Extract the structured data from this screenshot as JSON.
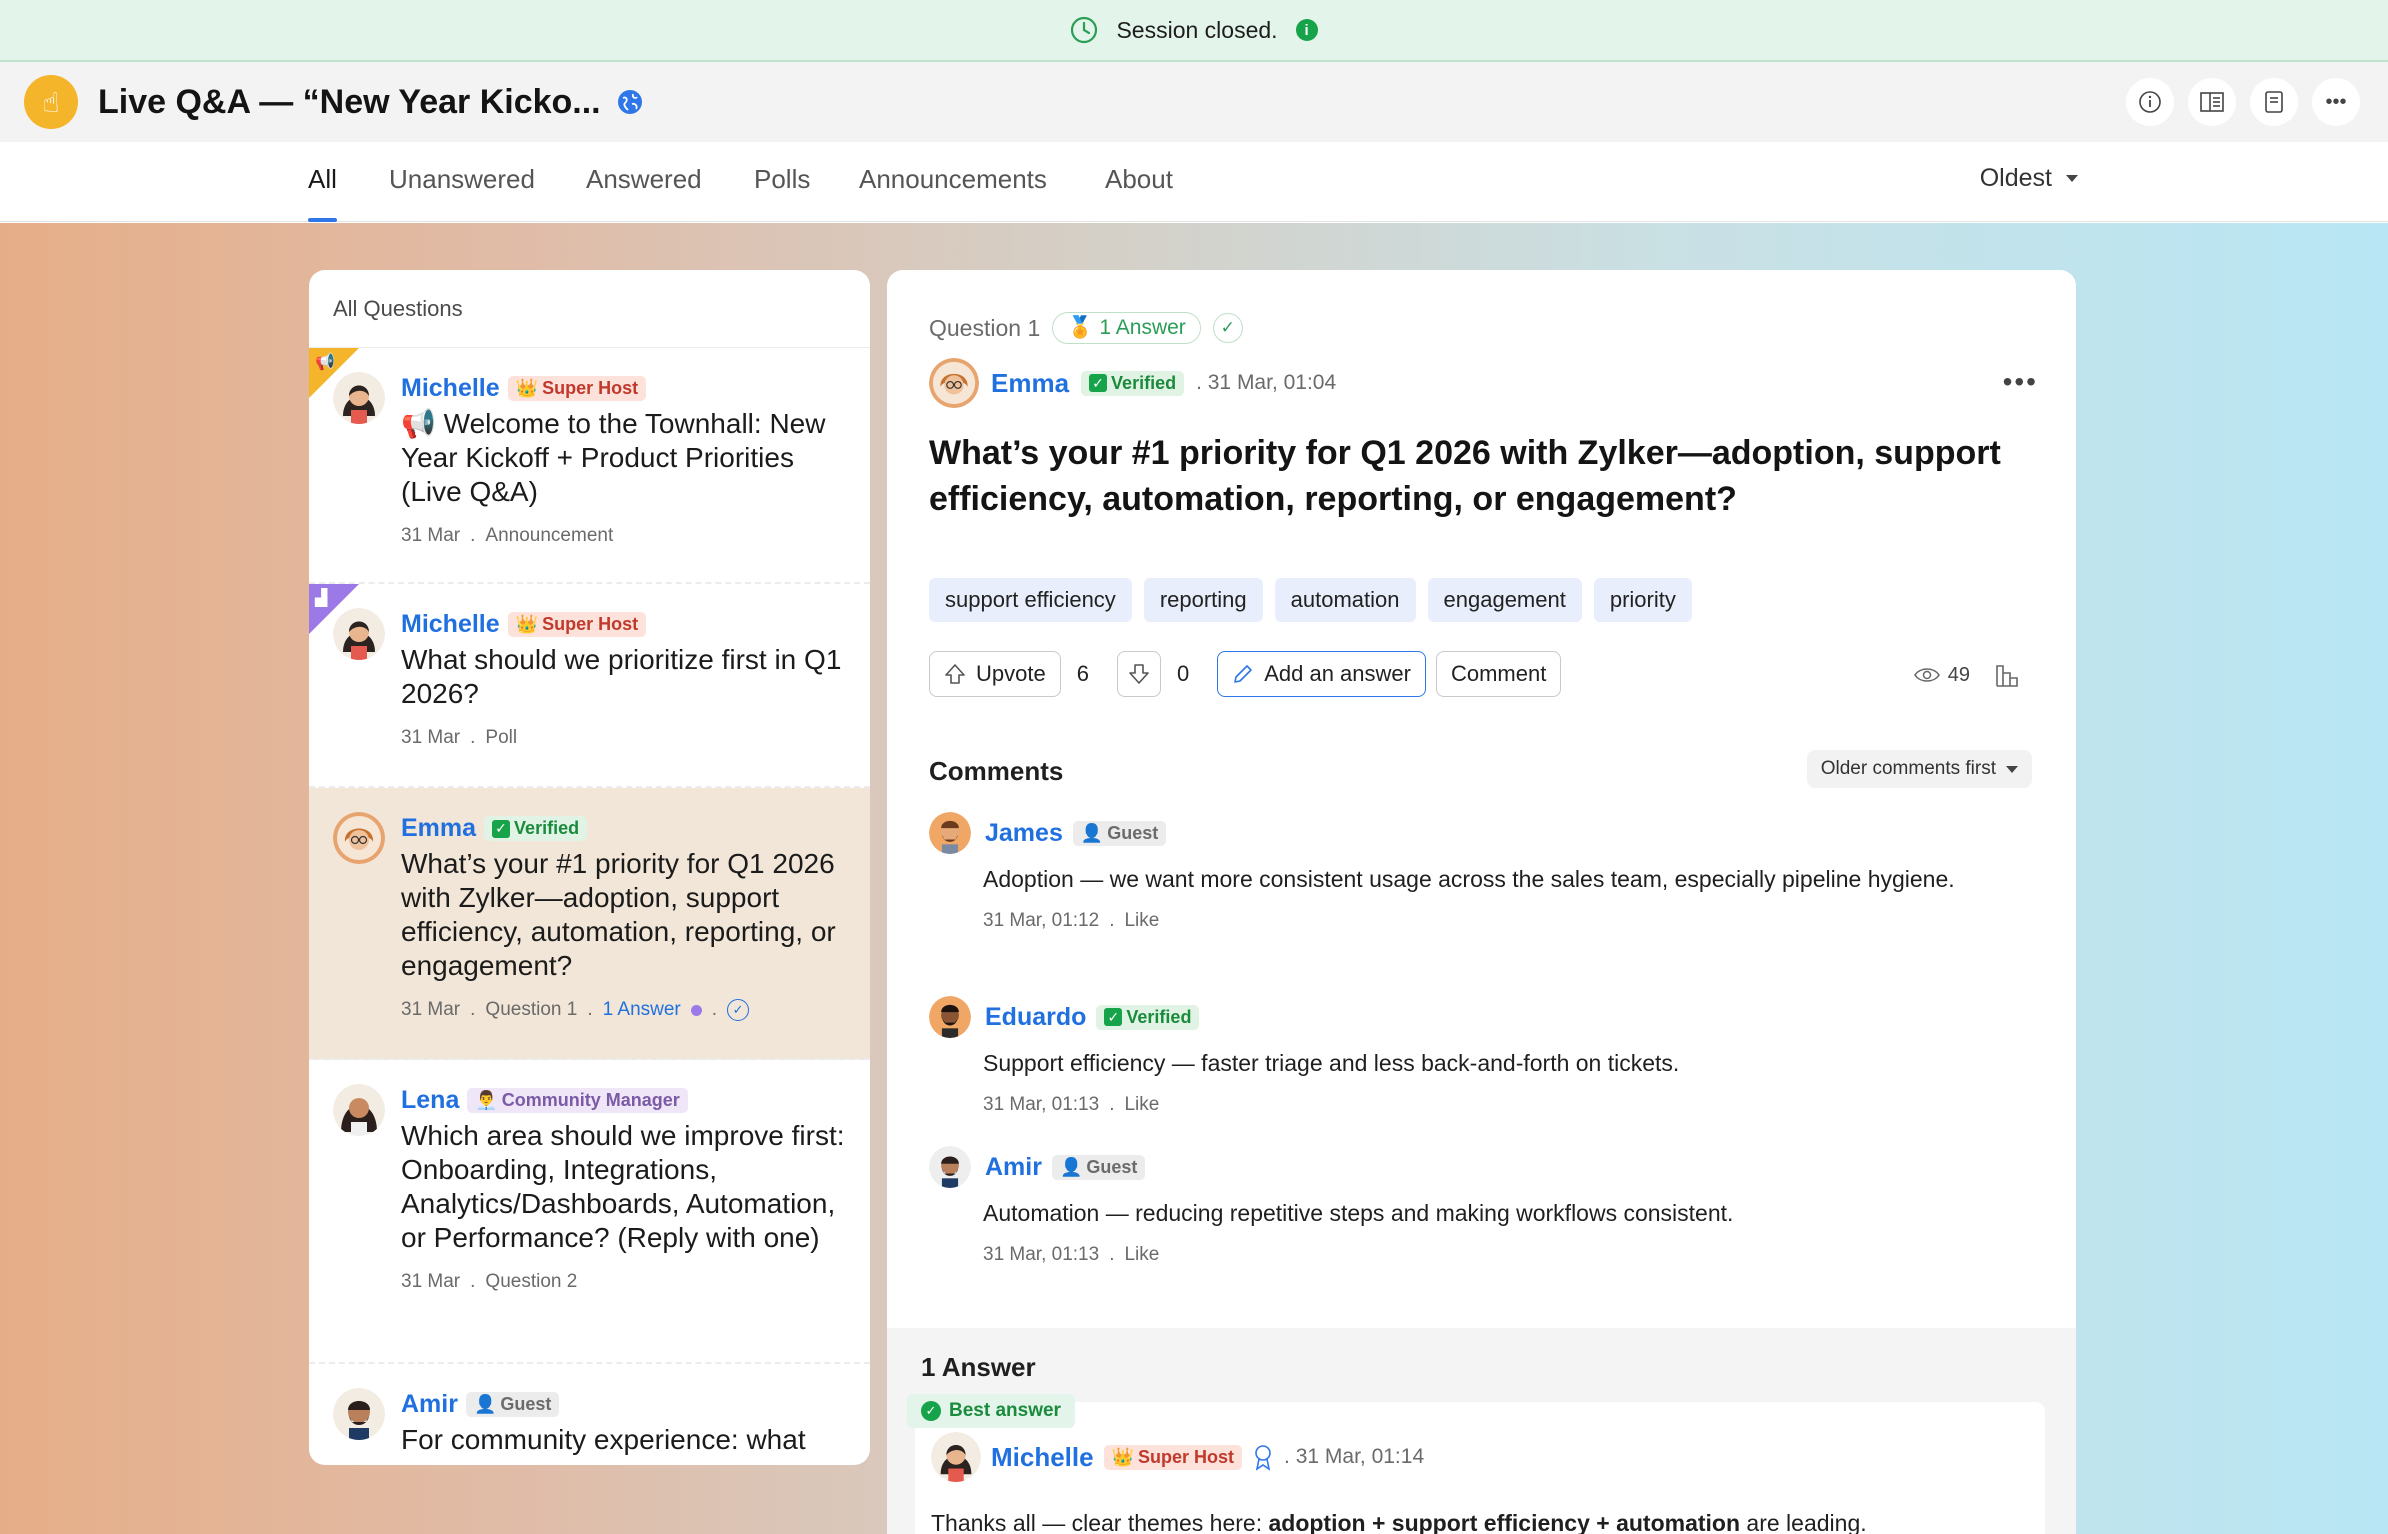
{
  "banner": {
    "text": "Session closed.",
    "info": "i"
  },
  "header": {
    "logo_glyph": "☝",
    "title": "Live Q&A — “New Year Kicko..."
  },
  "tabs": [
    {
      "label": "All",
      "active": true
    },
    {
      "label": "Unanswered"
    },
    {
      "label": "Answered"
    },
    {
      "label": "Polls"
    },
    {
      "label": "Announcements"
    },
    {
      "label": "About"
    }
  ],
  "sort": {
    "label": "Oldest"
  },
  "questions_panel": {
    "header": "All Questions",
    "items": [
      {
        "name": "Michelle",
        "badge": "Super Host",
        "text": "📢 Welcome to the Townhall: New Year Kickoff + Product Priorities (Live Q&A)",
        "date": "31 Mar",
        "kind": "Announcement",
        "sep": "."
      },
      {
        "name": "Michelle",
        "badge": "Super Host",
        "text": "What should we prioritize first in Q1 2026?",
        "date": "31 Mar",
        "kind": "Poll",
        "sep": "."
      },
      {
        "name": "Emma",
        "badge": "Verified",
        "text": "What’s your #1 priority for Q1 2026 with Zylker—adoption, support efficiency, automation, reporting, or engagement?",
        "date": "31 Mar",
        "kind": "Question 1",
        "answers": "1 Answer",
        "sep": "."
      },
      {
        "name": "Lena",
        "badge": "Community Manager",
        "text": "Which area should we improve first: Onboarding, Integrations, Analytics/Dashboards, Automation, or Performance? (Reply with one)",
        "date": "31 Mar",
        "kind": "Question 2",
        "sep": "."
      },
      {
        "name": "Amir",
        "badge": "Guest",
        "text": "For community experience: what"
      }
    ]
  },
  "detail": {
    "question_number": "Question 1",
    "answer_pill": "1 Answer",
    "author": "Emma",
    "author_badge": "Verified",
    "timestamp": ". 31 Mar, 01:04",
    "title": "What’s your #1 priority for Q1 2026 with Zylker—adoption, support efficiency, automation, reporting, or engagement?",
    "tags": [
      "support efficiency",
      "reporting",
      "automation",
      "engagement",
      "priority"
    ],
    "upvote_label": "Upvote",
    "upvotes": "6",
    "downvotes": "0",
    "add_answer_label": "Add an answer",
    "comment_label": "Comment",
    "views": "49",
    "comments_heading": "Comments",
    "comments_sort": "Older comments first",
    "comments": [
      {
        "name": "James",
        "badge": "Guest",
        "text": "Adoption — we want more consistent usage across the sales team, especially pipeline hygiene.",
        "time": "31 Mar, 01:12",
        "like": "Like",
        "sep": "."
      },
      {
        "name": "Eduardo",
        "badge": "Verified",
        "text": "Support efficiency — faster triage and less back-and-forth on tickets.",
        "time": "31 Mar, 01:13",
        "like": "Like",
        "sep": "."
      },
      {
        "name": "Amir",
        "badge": "Guest",
        "text": "Automation — reducing repetitive steps and making workflows consistent.",
        "time": "31 Mar, 01:13",
        "like": "Like",
        "sep": "."
      }
    ],
    "answers_heading": "1 Answer",
    "best_answer_label": "Best answer",
    "answer": {
      "name": "Michelle",
      "badge": "Super Host",
      "time": ". 31 Mar, 01:14",
      "text_start": "Thanks all — clear themes here: ",
      "text_bold": "adoption + support efficiency + automation",
      "text_end": " are leading."
    }
  },
  "colors": {
    "accent": "#2f76e9",
    "link": "#2070e0",
    "success": "#17a34a",
    "host_badge": "#c0392b"
  }
}
